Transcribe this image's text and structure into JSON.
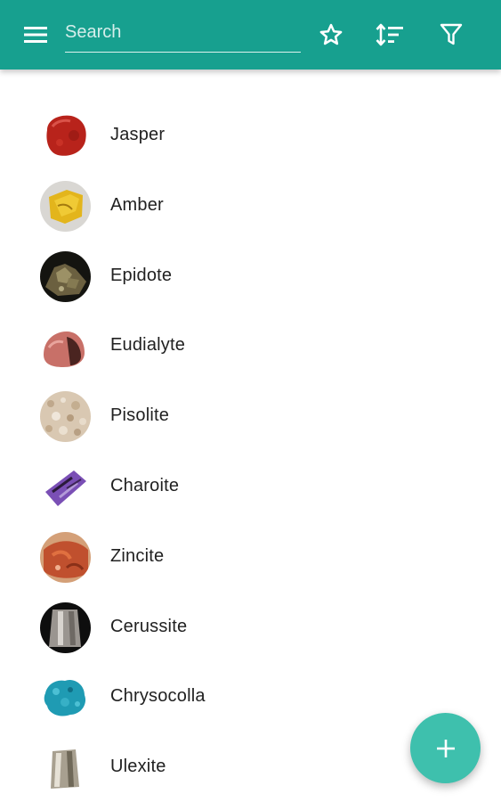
{
  "toolbar": {
    "menu_icon": "hamburger-menu-icon",
    "search_placeholder": "Search",
    "search_value": "",
    "favorites_icon": "star-outline-icon",
    "sort_icon": "sort-icon",
    "filter_icon": "filter-icon",
    "color": "#17a08f"
  },
  "minerals": [
    {
      "name": "Jasper",
      "color": "#c0281e"
    },
    {
      "name": "Amber",
      "color": "#e3b51c"
    },
    {
      "name": "Epidote",
      "color": "#6b6040"
    },
    {
      "name": "Eudialyte",
      "color": "#b8605a"
    },
    {
      "name": "Pisolite",
      "color": "#d9c8b2"
    },
    {
      "name": "Charoite",
      "color": "#7a4fb5"
    },
    {
      "name": "Zincite",
      "color": "#c0502e"
    },
    {
      "name": "Cerussite",
      "color": "#9a9590"
    },
    {
      "name": "Chrysocolla",
      "color": "#1f9bb3"
    },
    {
      "name": "Ulexite",
      "color": "#a8a090"
    }
  ],
  "fab": {
    "icon": "plus-icon",
    "color": "#3ec0ad"
  }
}
